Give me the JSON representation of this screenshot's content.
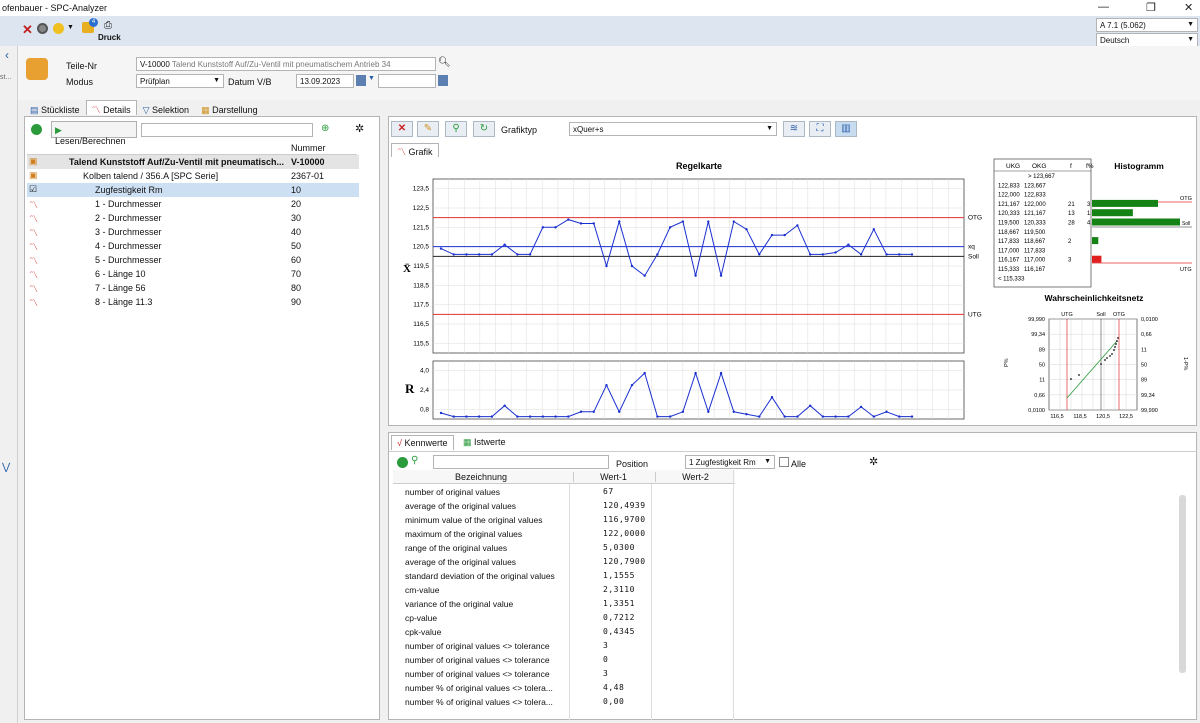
{
  "window": {
    "title": "ofenbauer - SPC-Analyzer",
    "min": "—",
    "restore": "❐",
    "close": "✕"
  },
  "toolbar": {
    "print_label": "Druck",
    "version": "A 7.1 (5.062)",
    "language": "Deutsch",
    "badge": "4"
  },
  "header": {
    "part_no_label": "Teile-Nr",
    "part_no_value": "V-10000",
    "part_no_desc": "Talend Kunststoff Auf/Zu-Ventil mit pneumatischem Antrieb  34",
    "mode_label": "Modus",
    "mode_value": "Prüfplan",
    "date_label": "Datum V/B",
    "date_value": "13.09.2023"
  },
  "sidebar": {
    "partial_text": "st..."
  },
  "tabs": [
    {
      "label": "Stückliste",
      "icon": "list-icon"
    },
    {
      "label": "Details",
      "icon": "chart-icon"
    },
    {
      "label": "Selektion",
      "icon": "filter-icon"
    },
    {
      "label": "Darstellung",
      "icon": "display-icon"
    }
  ],
  "tree": {
    "read_button": "Lesen/Berechnen",
    "col_number": "Nummer",
    "rows": [
      {
        "name": "Talend Kunststoff Auf/Zu-Ventil mit pneumatisch...",
        "num": "V-10000",
        "level": 0
      },
      {
        "name": "Kolben talend / 356.A   [SPC Serie]",
        "num": "2367-01",
        "level": 1
      },
      {
        "name": "Zugfestigkeit Rm",
        "num": "10",
        "level": 2
      },
      {
        "name": "1 - Durchmesser",
        "num": "20",
        "level": 2
      },
      {
        "name": "2 - Durchmesser",
        "num": "30",
        "level": 2
      },
      {
        "name": "3 - Durchmesser",
        "num": "40",
        "level": 2
      },
      {
        "name": "4 - Durchmesser",
        "num": "50",
        "level": 2
      },
      {
        "name": "5 - Durchmesser",
        "num": "60",
        "level": 2
      },
      {
        "name": "6 - Länge 10",
        "num": "70",
        "level": 2
      },
      {
        "name": "7 - Länge 56",
        "num": "80",
        "level": 2
      },
      {
        "name": "8 - Länge 11.3",
        "num": "90",
        "level": 2
      }
    ]
  },
  "chart_toolbar": {
    "type_label": "Grafiktyp",
    "type_value": "xQuer+s",
    "tab": "Grafik"
  },
  "chart_data": [
    {
      "type": "line",
      "title": "Regelkarte",
      "ylabel": "X̄",
      "yticks": [
        "123,5",
        "122,5",
        "121,5",
        "120,5",
        "119,5",
        "118,5",
        "117,5",
        "116,5",
        "115,5"
      ],
      "ylim": [
        115,
        124
      ],
      "lines": {
        "OTG": 122,
        "xq": 120.5,
        "Soll": 120,
        "UTG": 117
      },
      "line_labels": {
        "otg": "OTG",
        "xq": "xq",
        "soll": "Soll",
        "utg": "UTG"
      },
      "values": [
        120.4,
        120.1,
        120.1,
        120.1,
        120.1,
        120.6,
        120.1,
        120.1,
        121.5,
        121.5,
        121.9,
        121.7,
        121.7,
        119.5,
        121.8,
        119.5,
        119.0,
        120.1,
        121.5,
        121.8,
        119.0,
        121.8,
        119.0,
        121.8,
        121.4,
        120.1,
        121.1,
        121.1,
        121.6,
        120.1,
        120.1,
        120.2,
        120.6,
        120.1,
        121.4,
        120.1,
        120.1,
        120.1
      ]
    },
    {
      "type": "line",
      "ylabel": "R",
      "yticks": [
        "4,0",
        "2,4",
        "0,8"
      ],
      "ylim": [
        0,
        4.8
      ],
      "values": [
        0.5,
        0.2,
        0.2,
        0.2,
        0.2,
        1.1,
        0.2,
        0.2,
        0.2,
        0.2,
        0.2,
        0.6,
        0.6,
        2.8,
        0.6,
        2.8,
        3.8,
        0.2,
        0.2,
        0.6,
        3.8,
        0.6,
        3.8,
        0.6,
        0.4,
        0.2,
        1.8,
        0.2,
        0.2,
        1.1,
        0.2,
        0.2,
        0.2,
        1.0,
        0.2,
        0.6,
        0.2,
        0.2
      ]
    },
    {
      "type": "bar",
      "title": "Histogramm",
      "columns": [
        "UKG",
        "OKG",
        "f",
        "f%"
      ],
      "rows": [
        {
          "ukg": "",
          "okg": "> 123,667",
          "f": "",
          "p": ""
        },
        {
          "ukg": "122,833",
          "okg": "123,667",
          "f": "",
          "p": ""
        },
        {
          "ukg": "122,000",
          "okg": "122,833",
          "f": "",
          "p": ""
        },
        {
          "ukg": "121,167",
          "okg": "122,000",
          "f": "21",
          "p": "3"
        },
        {
          "ukg": "120,333",
          "okg": "121,167",
          "f": "13",
          "p": "1"
        },
        {
          "ukg": "119,500",
          "okg": "120,333",
          "f": "28",
          "p": "4"
        },
        {
          "ukg": "118,667",
          "okg": "119,500",
          "f": "",
          "p": ""
        },
        {
          "ukg": "117,833",
          "okg": "118,667",
          "f": "2",
          "p": ""
        },
        {
          "ukg": "117,000",
          "okg": "117,833",
          "f": "",
          "p": ""
        },
        {
          "ukg": "116,167",
          "okg": "117,000",
          "f": "3",
          "p": ""
        },
        {
          "ukg": "115,333",
          "okg": "116,167",
          "f": "",
          "p": ""
        },
        {
          "ukg": "< 115,333",
          "okg": "",
          "f": "",
          "p": ""
        }
      ],
      "bars": [
        0,
        0,
        0,
        21,
        13,
        28,
        0,
        2,
        0,
        3,
        0,
        0
      ],
      "labels": {
        "otg": "OTG",
        "soll": "Soll",
        "utg": "UTG"
      }
    },
    {
      "type": "scatter",
      "title": "Wahrscheinlichkeitsnetz",
      "left_ticks": [
        "99,990",
        "99,34",
        "89",
        "50",
        "11",
        "0,66",
        "0,0100"
      ],
      "right_ticks": [
        "0,0100",
        "0,66",
        "11",
        "50",
        "89",
        "99,34",
        "99,990"
      ],
      "xticks": [
        "116,5",
        "118,5",
        "120,5",
        "122,5"
      ],
      "ylabel_left": "P%",
      "ylabel_right": "1-P%",
      "top_labels": {
        "utg": "UTG",
        "soll": "Soll",
        "otg": "OTG"
      }
    }
  ],
  "kennwerte": {
    "tabs": [
      "Kennwerte",
      "Istwerte"
    ],
    "position_label": "Position",
    "position_value": "1 Zugfestigkeit Rm",
    "all_label": "Alle",
    "columns": [
      "Bezeichnung",
      "Wert-1",
      "Wert-2"
    ],
    "rows": [
      {
        "k": "number of original values",
        "v": "67"
      },
      {
        "k": "average of the original values",
        "v": "120,4939"
      },
      {
        "k": "minimum value of the original values",
        "v": "116,9700"
      },
      {
        "k": "maximum of the original values",
        "v": "122,0000"
      },
      {
        "k": "range of the original values",
        "v": "5,0300"
      },
      {
        "k": "average of the original values",
        "v": "120,7900"
      },
      {
        "k": "standard deviation of the original values",
        "v": "1,1555"
      },
      {
        "k": "cm-value",
        "v": "2,3110"
      },
      {
        "k": "variance of the original value",
        "v": "1,3351"
      },
      {
        "k": "cp-value",
        "v": "0,7212"
      },
      {
        "k": "cpk-value",
        "v": "0,4345"
      },
      {
        "k": "number of original values <> tolerance",
        "v": "3"
      },
      {
        "k": "number of original values <> tolerance",
        "v": "0"
      },
      {
        "k": "number of original values <> tolerance",
        "v": "3"
      },
      {
        "k": "number % of original values <> tolera...",
        "v": "4,48"
      },
      {
        "k": "number % of original values <> tolera...",
        "v": "0,00"
      }
    ]
  },
  "colors": {
    "accent": "#2a5caa",
    "limit": "#e03030",
    "series": "#1a2fd0",
    "bar": "#148214"
  }
}
